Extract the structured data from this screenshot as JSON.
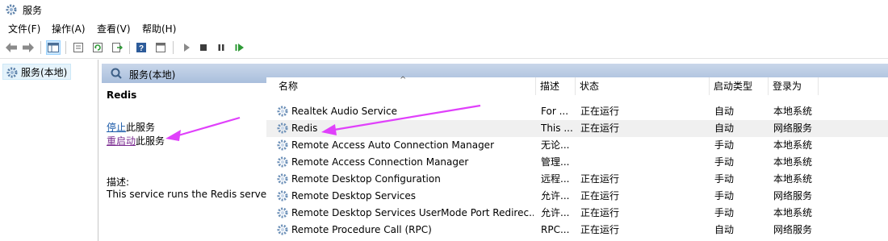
{
  "window": {
    "title": "服务"
  },
  "menu": [
    "文件(F)",
    "操作(A)",
    "查看(V)",
    "帮助(H)"
  ],
  "toolbar": {
    "buttons": [
      "back-icon",
      "forward-icon",
      "show-hide-tree-icon",
      "properties-icon",
      "refresh-icon",
      "export-list-icon",
      "help-icon",
      "console-icon",
      "start-icon",
      "stop-icon",
      "pause-icon",
      "restart-icon"
    ]
  },
  "tree": {
    "root_label": "服务(本地)"
  },
  "panel": {
    "header": "服务(本地)"
  },
  "details": {
    "service_name": "Redis",
    "stop_link": "停止",
    "stop_suffix": "此服务",
    "restart_link": "重启动",
    "restart_suffix": "此服务",
    "desc_label": "描述:",
    "desc_text": "This service runs the Redis server"
  },
  "columns": [
    "名称",
    "描述",
    "状态",
    "启动类型",
    "登录为"
  ],
  "rows": [
    {
      "name": "Realtek Audio Service",
      "desc": "For ...",
      "status": "正在运行",
      "startup": "自动",
      "logon": "本地系统"
    },
    {
      "name": "Redis",
      "desc": "This ...",
      "status": "正在运行",
      "startup": "自动",
      "logon": "网络服务",
      "selected": true
    },
    {
      "name": "Remote Access Auto Connection Manager",
      "desc": "无论...",
      "status": "",
      "startup": "手动",
      "logon": "本地系统"
    },
    {
      "name": "Remote Access Connection Manager",
      "desc": "管理...",
      "status": "",
      "startup": "手动",
      "logon": "本地系统"
    },
    {
      "name": "Remote Desktop Configuration",
      "desc": "远程...",
      "status": "正在运行",
      "startup": "手动",
      "logon": "本地系统"
    },
    {
      "name": "Remote Desktop Services",
      "desc": "允许...",
      "status": "正在运行",
      "startup": "手动",
      "logon": "网络服务"
    },
    {
      "name": "Remote Desktop Services UserMode Port Redirec...",
      "desc": "允许...",
      "status": "正在运行",
      "startup": "手动",
      "logon": "本地系统"
    },
    {
      "name": "Remote Procedure Call (RPC)",
      "desc": "RPC...",
      "status": "正在运行",
      "startup": "自动",
      "logon": "网络服务"
    }
  ],
  "colors": {
    "annotation_arrow": "#e040fb",
    "header_band": "#b0c4de",
    "link": "#1a5aa8",
    "visited_link": "#7b2c91"
  }
}
